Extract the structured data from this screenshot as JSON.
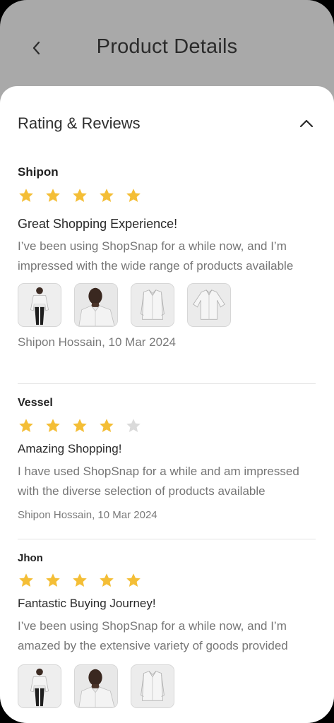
{
  "header": {
    "title": "Product Details",
    "back_icon": "chevron-left-icon"
  },
  "section": {
    "title": "Rating & Reviews",
    "toggle_icon": "chevron-up-icon"
  },
  "colors": {
    "star_filled": "#F4BE36",
    "star_empty": "#DADADA",
    "sheet_bg": "#FFFFFF",
    "overlay_bg": "#A9A9A9"
  },
  "reviews": [
    {
      "name": "Shipon",
      "rating": 5,
      "title": "Great Shopping Experience!",
      "body": "I’ve been using ShopSnap for a while now, and I’m impressed with the wide range of products available",
      "photos": [
        "model-shirt-full",
        "model-shirt-closeup",
        "shirt-folded",
        "shirt-flat"
      ],
      "meta": "Shipon Hossain, 10 Mar 2024"
    },
    {
      "name": "Vessel",
      "rating": 4,
      "title": "Amazing Shopping!",
      "body": "I have used ShopSnap for a while and am impressed with the diverse selection of products available",
      "photos": [],
      "meta": "Shipon Hossain, 10 Mar 2024"
    },
    {
      "name": "Jhon",
      "rating": 5,
      "title": "Fantastic Buying Journey!",
      "body": "I’ve been using ShopSnap for a while now, and I’m amazed by the extensive variety of goods provided",
      "photos": [
        "model-shirt-full",
        "model-shirt-closeup",
        "shirt-folded"
      ],
      "meta": ""
    }
  ]
}
